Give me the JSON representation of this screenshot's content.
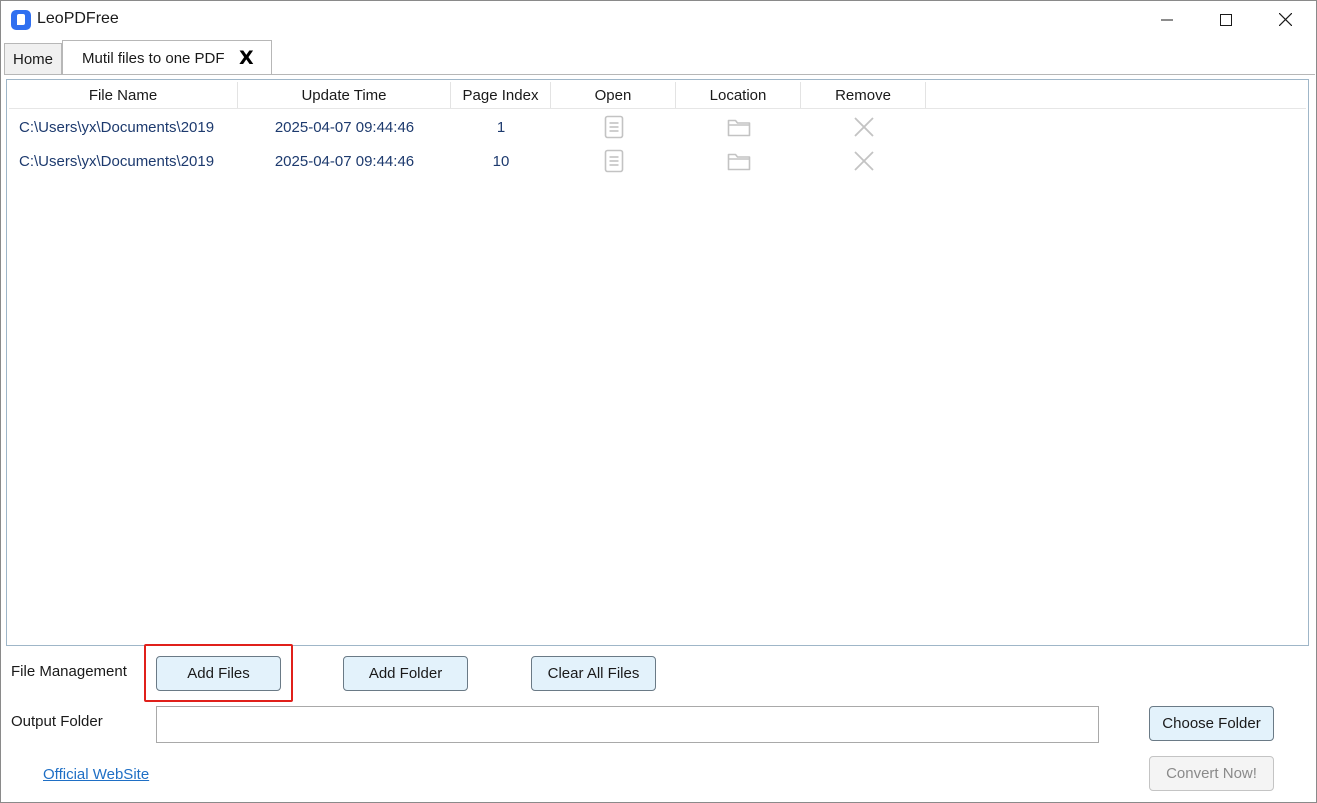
{
  "window": {
    "title": "LeoPDFree",
    "controls": {
      "minimize": "minimize-icon",
      "maximize": "maximize-icon",
      "close": "close-icon"
    }
  },
  "tabs": {
    "home_label": "Home",
    "active_label": "Mutil files to one PDF",
    "active_close": "X"
  },
  "table": {
    "headers": [
      "File Name",
      "Update Time",
      "Page Index",
      "Open",
      "Location",
      "Remove"
    ],
    "rows": [
      {
        "file_name": "C:\\Users\\yx\\Documents\\2019",
        "update_time": "2025-04-07 09:44:46",
        "page_index": "1",
        "open": "document-icon",
        "location": "folder-icon",
        "remove": "x-icon"
      },
      {
        "file_name": "C:\\Users\\yx\\Documents\\2019",
        "update_time": "2025-04-07 09:44:46",
        "page_index": "10",
        "open": "document-icon",
        "location": "folder-icon",
        "remove": "x-icon"
      }
    ]
  },
  "file_management": {
    "label": "File Management",
    "add_files": "Add Files",
    "add_folder": "Add Folder",
    "clear_all": "Clear All Files"
  },
  "output": {
    "label": "Output Folder",
    "value": "",
    "choose_folder": "Choose Folder"
  },
  "footer": {
    "official_site": "Official WebSite",
    "convert": "Convert Now!"
  },
  "colors": {
    "row_text": "#1d3a6e",
    "button_bg": "#e3f2fb",
    "highlight": "#e0201b",
    "link": "#1f6fc5",
    "app_icon": "#2f6ff0"
  }
}
